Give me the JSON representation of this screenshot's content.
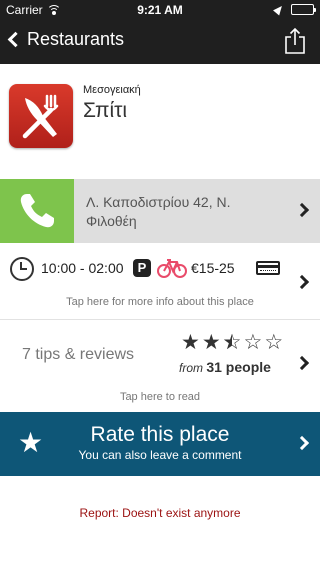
{
  "status_bar": {
    "carrier": "Carrier",
    "time": "9:21 AM",
    "battery_level": 1.0,
    "icons": [
      "wifi-icon",
      "location-arrow-icon",
      "battery-icon"
    ]
  },
  "nav": {
    "back_label": "Restaurants",
    "share_icon": "share-icon",
    "background": "#1f1f1f"
  },
  "place": {
    "category": "Μεσογειακή",
    "name": "Σπίτι",
    "icon": "fork-knife-icon",
    "icon_color": "#c42a22"
  },
  "address": {
    "text": "Λ. Καποδιστρίου 42, Ν. Φιλοθέη",
    "phone_icon": "phone-icon",
    "phone_color": "#7ec44c"
  },
  "info": {
    "hours": "10:00 - 02:00",
    "parking_label": "P",
    "price": "€15-25",
    "amenities": [
      "clock-icon",
      "parking-icon",
      "bicycle-icon",
      "credit-card-icon"
    ],
    "bike_color": "#e94b6a",
    "hint": "Tap here for more info about this place"
  },
  "tips": {
    "label": "7 tips & reviews",
    "rating": 2.5,
    "rating_max": 5,
    "from_word": "from",
    "people": "31 people",
    "hint": "Tap here to read"
  },
  "rate": {
    "title": "Rate this place",
    "subtitle": "You can also leave a comment",
    "background": "#0e5677"
  },
  "report": {
    "label": "Report: Doesn't exist anymore",
    "color": "#9b1111"
  }
}
